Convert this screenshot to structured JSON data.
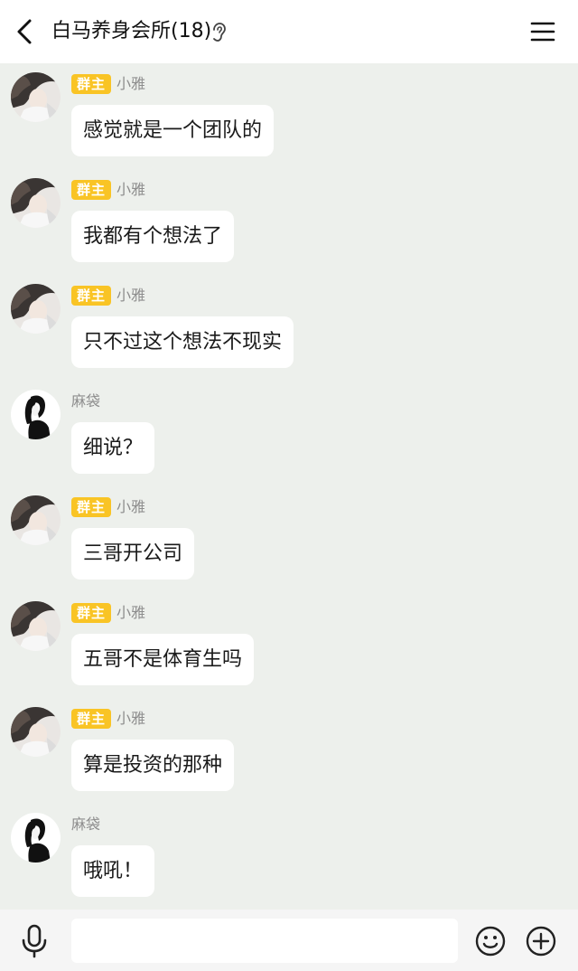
{
  "header": {
    "title": "白马养身会所(18)",
    "back_icon": "chevron-left-icon",
    "ear_icon": "ear-icon",
    "menu_icon": "hamburger-menu-icon"
  },
  "messages": [
    {
      "badge": "群主",
      "sender": "小雅",
      "text": "感觉就是一个团队的",
      "avatar": "xiaoya"
    },
    {
      "badge": "群主",
      "sender": "小雅",
      "text": "我都有个想法了",
      "avatar": "xiaoya"
    },
    {
      "badge": "群主",
      "sender": "小雅",
      "text": "只不过这个想法不现实",
      "avatar": "xiaoya"
    },
    {
      "badge": "",
      "sender": "麻袋",
      "text": "细说？",
      "avatar": "madai"
    },
    {
      "badge": "群主",
      "sender": "小雅",
      "text": "三哥开公司",
      "avatar": "xiaoya"
    },
    {
      "badge": "群主",
      "sender": "小雅",
      "text": "五哥不是体育生吗",
      "avatar": "xiaoya"
    },
    {
      "badge": "群主",
      "sender": "小雅",
      "text": "算是投资的那种",
      "avatar": "xiaoya"
    },
    {
      "badge": "",
      "sender": "麻袋",
      "text": "哦吼！",
      "avatar": "madai"
    }
  ],
  "input_bar": {
    "placeholder": "",
    "value": "",
    "mic_icon": "microphone-icon",
    "emoji_icon": "smiley-icon",
    "plus_icon": "plus-circle-icon"
  },
  "colors": {
    "background": "#edf0ec",
    "badge": "#f9c425",
    "bubble": "#ffffff"
  }
}
